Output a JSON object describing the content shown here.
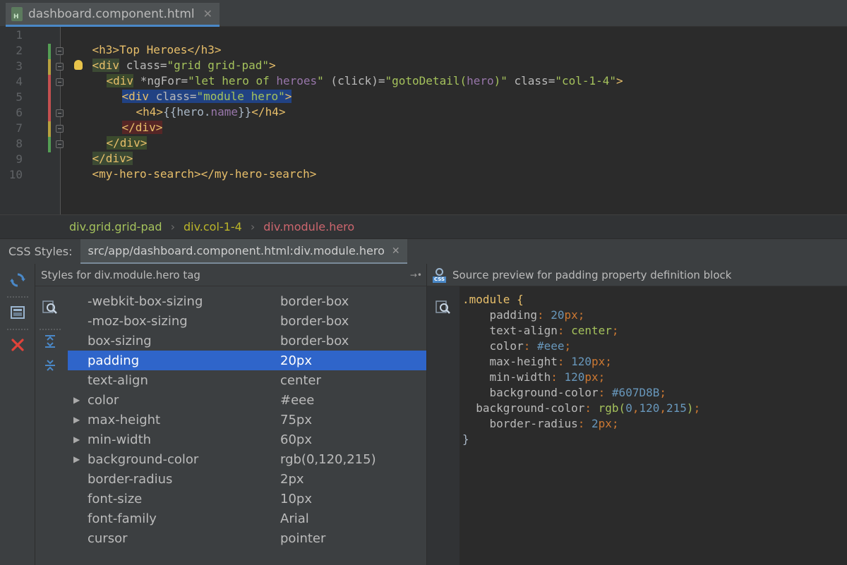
{
  "editor_tab": {
    "file_name": "dashboard.component.html",
    "file_badge": "H",
    "close_glyph": "✕"
  },
  "line_numbers": [
    "1",
    "2",
    "3",
    "4",
    "5",
    "6",
    "7",
    "8",
    "9",
    "10"
  ],
  "code": {
    "l1": "<h3>Top Heroes</h3>",
    "l2_open": "<div",
    "l2_attr": " class=",
    "l2_val": "\"grid grid-pad\"",
    "l2_close": ">",
    "l3_open": "<div",
    "l3_attr1": " *ngFor=",
    "l3_val1a": "\"let hero of ",
    "l3_val1b": "heroes",
    "l3_val1c": "\"",
    "l3_attr2": " (click)=",
    "l3_val2a": "\"gotoDetail(",
    "l3_val2b": "hero",
    "l3_val2c": ")\"",
    "l3_attr3": " class=",
    "l3_val3": "\"col-1-4\"",
    "l3_close": ">",
    "l4_open": "<div",
    "l4_attr": " class=",
    "l4_val": "\"module hero\"",
    "l4_close": ">",
    "l5_open": "<h4>",
    "l5_expr_a": "{{",
    "l5_expr_b": "hero",
    "l5_expr_c": ".",
    "l5_expr_d": "name",
    "l5_expr_e": "}}",
    "l5_close": "</h4>",
    "l6": "</div>",
    "l7": "</div>",
    "l8": "</div>",
    "l9": "<my-hero-search></my-hero-search>"
  },
  "breadcrumb": [
    "div.grid.grid-pad",
    "div.col-1-4",
    "div.module.hero"
  ],
  "breadcrumb_sep": "›",
  "css_panel": {
    "title": "CSS Styles:",
    "tab_label": "src/app/dashboard.component.html:div.module.hero",
    "tab_close": "✕",
    "styles_title": "Styles for div.module.hero tag",
    "pin_glyph": "→•",
    "preview_title": "Source preview for padding property definition block",
    "css_icon_label": "CSS"
  },
  "properties": [
    {
      "name": "-webkit-box-sizing",
      "value": "border-box",
      "expandable": false,
      "selected": false
    },
    {
      "name": "-moz-box-sizing",
      "value": "border-box",
      "expandable": false,
      "selected": false
    },
    {
      "name": "box-sizing",
      "value": "border-box",
      "expandable": false,
      "selected": false
    },
    {
      "name": "padding",
      "value": "20px",
      "expandable": false,
      "selected": true
    },
    {
      "name": "text-align",
      "value": "center",
      "expandable": false,
      "selected": false
    },
    {
      "name": "color",
      "value": "#eee",
      "expandable": true,
      "selected": false
    },
    {
      "name": "max-height",
      "value": "75px",
      "expandable": true,
      "selected": false
    },
    {
      "name": "min-width",
      "value": "60px",
      "expandable": true,
      "selected": false
    },
    {
      "name": "background-color",
      "value": "rgb(0,120,215)",
      "expandable": true,
      "selected": false
    },
    {
      "name": "border-radius",
      "value": "2px",
      "expandable": false,
      "selected": false
    },
    {
      "name": "font-size",
      "value": "10px",
      "expandable": false,
      "selected": false
    },
    {
      "name": "font-family",
      "value": "Arial",
      "expandable": false,
      "selected": false
    },
    {
      "name": "cursor",
      "value": "pointer",
      "expandable": false,
      "selected": false
    }
  ],
  "preview": {
    "selector": ".module {",
    "p1_name": "padding",
    "p1_num": "20",
    "p1_unit": "px",
    "p2_name": "text-align",
    "p2_val": "center",
    "p3_name": "color",
    "p3_val": "#eee",
    "p4_name": "max-height",
    "p4_num": "120",
    "p4_unit": "px",
    "p5_name": "min-width",
    "p5_num": "120",
    "p5_unit": "px",
    "p6_name": "background-color",
    "p6_val": "#607D8B",
    "p7_name": "background-color",
    "p7_fn": "rgb(",
    "p7_a": "0",
    "p7_b": "120",
    "p7_c": "215",
    "p7_end": ")",
    "p8_name": "border-radius",
    "p8_num": "2",
    "p8_unit": "px",
    "close": "}"
  },
  "colors": {
    "selection": "#2f65ca",
    "tag": "#e8bf6a",
    "string": "#a5c25c",
    "number": "#6897bb",
    "keyword_orange": "#cc7832"
  },
  "icons": {
    "refresh": "refresh-icon",
    "layout": "layout-icon",
    "close": "close-red-icon",
    "find": "find-icon",
    "expand_all": "expand-all-icon",
    "collapse_all": "collapse-all-icon"
  }
}
